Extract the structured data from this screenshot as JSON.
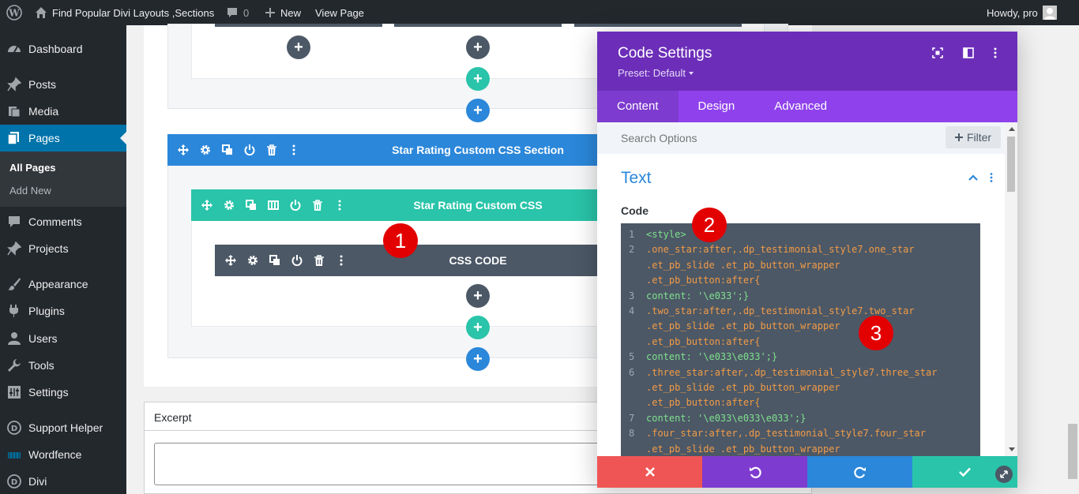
{
  "admin_bar": {
    "site_title": "Find Popular Divi Layouts ,Sections",
    "comments_count": "0",
    "new_label": "New",
    "view_page_label": "View Page",
    "howdy": "Howdy, pro"
  },
  "sidebar": {
    "items": [
      {
        "label": "Dashboard",
        "icon": "dashboard-icon"
      },
      {
        "label": "Posts",
        "icon": "pin-icon"
      },
      {
        "label": "Media",
        "icon": "media-icon"
      },
      {
        "label": "Pages",
        "icon": "pages-icon"
      },
      {
        "label": "Comments",
        "icon": "comment-icon"
      },
      {
        "label": "Projects",
        "icon": "pin-icon"
      },
      {
        "label": "Appearance",
        "icon": "brush-icon"
      },
      {
        "label": "Plugins",
        "icon": "plugin-icon"
      },
      {
        "label": "Users",
        "icon": "user-icon"
      },
      {
        "label": "Tools",
        "icon": "wrench-icon"
      },
      {
        "label": "Settings",
        "icon": "settings-icon"
      },
      {
        "label": "Support Helper",
        "icon": "divi-icon"
      },
      {
        "label": "Wordfence",
        "icon": "wordfence-icon"
      },
      {
        "label": "Divi",
        "icon": "divi-icon"
      }
    ],
    "pages_sub": [
      "All Pages",
      "Add New"
    ]
  },
  "builder": {
    "section_title": "Star Rating Custom CSS Section",
    "row_title": "Star Rating Custom CSS",
    "module_title": "CSS CODE"
  },
  "annotations": [
    "1",
    "2",
    "3"
  ],
  "excerpt": {
    "label": "Excerpt"
  },
  "modal": {
    "title": "Code Settings",
    "preset": "Preset: Default",
    "tabs": [
      "Content",
      "Design",
      "Advanced"
    ],
    "search_placeholder": "Search Options",
    "filter_label": "Filter",
    "group_title": "Text",
    "field_label": "Code",
    "code_lines": [
      {
        "n": "1",
        "t": "<style>"
      },
      {
        "n": "2",
        "t": ".one_star:after,.dp_testimonial_style7.one_star"
      },
      {
        "n": "",
        "t": ".et_pb_slide .et_pb_button_wrapper"
      },
      {
        "n": "",
        "t": ".et_pb_button:after{"
      },
      {
        "n": "3",
        "t": "content: '\\e033';}"
      },
      {
        "n": "4",
        "t": ".two_star:after,.dp_testimonial_style7.two_star"
      },
      {
        "n": "",
        "t": ".et_pb_slide .et_pb_button_wrapper"
      },
      {
        "n": "",
        "t": ".et_pb_button:after{"
      },
      {
        "n": "5",
        "t": "content: '\\e033\\e033';}"
      },
      {
        "n": "6",
        "t": ".three_star:after,.dp_testimonial_style7.three_star"
      },
      {
        "n": "",
        "t": ".et_pb_slide .et_pb_button_wrapper"
      },
      {
        "n": "",
        "t": ".et_pb_button:after{"
      },
      {
        "n": "7",
        "t": "content: '\\e033\\e033\\e033';}"
      },
      {
        "n": "8",
        "t": ".four_star:after,.dp_testimonial_style7.four_star"
      },
      {
        "n": "",
        "t": ".et_pb_slide .et_pb_button_wrapper"
      }
    ]
  },
  "colors": {
    "admin_bg": "#23282d",
    "wp_blue": "#0073aa",
    "section_blue": "#2b87da",
    "row_teal": "#29c4a9",
    "module_dark": "#4c5866",
    "modal_purple": "#6c2eb9",
    "tabs_purple": "#8f42ec",
    "cancel_red": "#ef5555",
    "undo_purple": "#7e3bd0",
    "redo_blue": "#2b87da",
    "save_green": "#29c4a9",
    "annotation_red": "#e20000"
  }
}
